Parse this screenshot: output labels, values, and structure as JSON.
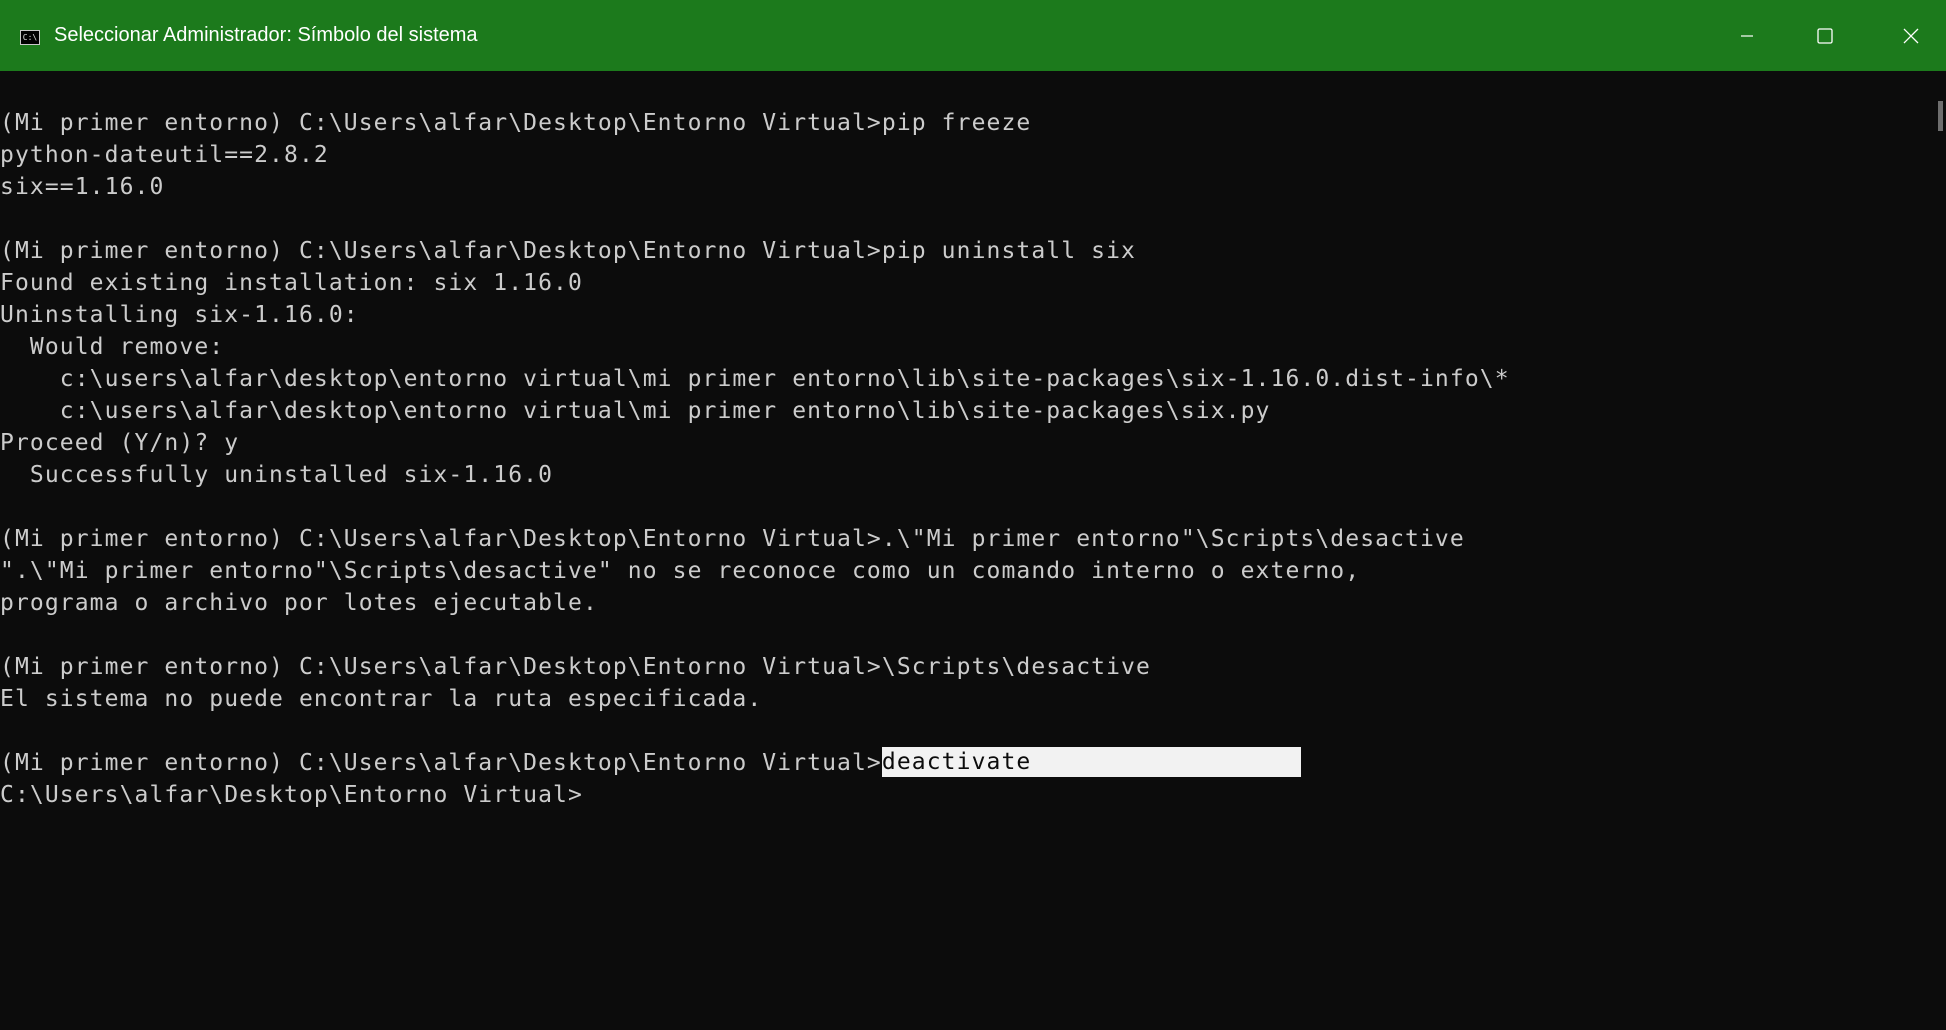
{
  "window": {
    "title": "Seleccionar Administrador: Símbolo del sistema",
    "icon_label": "C:\\",
    "icon": "cmd-icon",
    "controls": {
      "minimize_icon": "minimize-icon",
      "maximize_icon": "maximize-icon",
      "close_icon": "close-icon"
    },
    "colors": {
      "titlebar": "#1c7a1c",
      "background": "#0c0c0c",
      "text": "#cccccc",
      "selection": "#f2f2f2"
    }
  },
  "console": {
    "lines": [
      "(Mi primer entorno) C:\\Users\\alfar\\Desktop\\Entorno Virtual>pip freeze",
      "python-dateutil==2.8.2",
      "six==1.16.0",
      "",
      "(Mi primer entorno) C:\\Users\\alfar\\Desktop\\Entorno Virtual>pip uninstall six",
      "Found existing installation: six 1.16.0",
      "Uninstalling six-1.16.0:",
      "  Would remove:",
      "    c:\\users\\alfar\\desktop\\entorno virtual\\mi primer entorno\\lib\\site-packages\\six-1.16.0.dist-info\\*",
      "    c:\\users\\alfar\\desktop\\entorno virtual\\mi primer entorno\\lib\\site-packages\\six.py",
      "Proceed (Y/n)? y",
      "  Successfully uninstalled six-1.16.0",
      "",
      "(Mi primer entorno) C:\\Users\\alfar\\Desktop\\Entorno Virtual>.\\\"Mi primer entorno\"\\Scripts\\desactive",
      "\".\\\"Mi primer entorno\"\\Scripts\\desactive\" no se reconoce como un comando interno o externo,",
      "programa o archivo por lotes ejecutable.",
      "",
      "(Mi primer entorno) C:\\Users\\alfar\\Desktop\\Entorno Virtual>\\Scripts\\desactive",
      "El sistema no puede encontrar la ruta especificada.",
      ""
    ],
    "selected_prompt": "(Mi primer entorno) C:\\Users\\alfar\\Desktop\\Entorno Virtual>",
    "selected_text": "deactivate",
    "final_prompt": "C:\\Users\\alfar\\Desktop\\Entorno Virtual>"
  }
}
